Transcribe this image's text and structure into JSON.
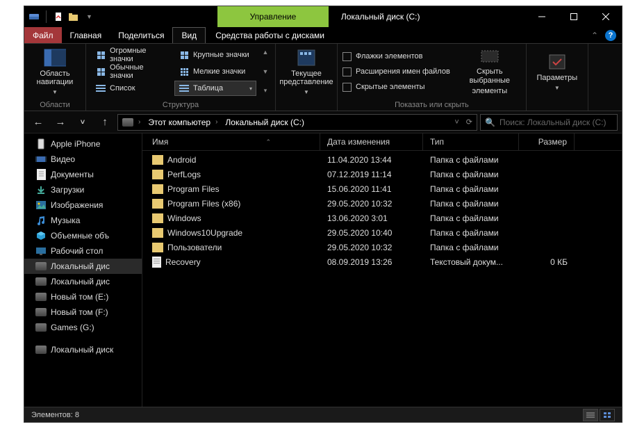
{
  "window": {
    "manage_tab": "Управление",
    "title": "Локальный диск (C:)"
  },
  "menu": {
    "file": "Файл",
    "home": "Главная",
    "share": "Поделиться",
    "view": "Вид",
    "drive_tools": "Средства работы с дисками"
  },
  "ribbon": {
    "nav_pane": "Область навигации",
    "panes_label": "Области",
    "views": {
      "extra_large": "Огромные значки",
      "large": "Крупные значки",
      "medium": "Обычные значки",
      "small": "Мелкие значки",
      "list": "Список",
      "details": "Таблица"
    },
    "layout_label": "Структура",
    "current_view": "Текущее представление",
    "checkboxes": "Флажки элементов",
    "extensions": "Расширения имен файлов",
    "hidden": "Скрытые элементы",
    "hide_selected_l1": "Скрыть выбранные",
    "hide_selected_l2": "элементы",
    "show_hide_label": "Показать или скрыть",
    "options": "Параметры"
  },
  "address": {
    "this_pc": "Этот компьютер",
    "current": "Локальный диск (C:)"
  },
  "search": {
    "placeholder": "Поиск: Локальный диск (C:)"
  },
  "tree": [
    {
      "icon": "phone",
      "label": "Apple iPhone"
    },
    {
      "icon": "video",
      "label": "Видео"
    },
    {
      "icon": "doc",
      "label": "Документы"
    },
    {
      "icon": "down",
      "label": "Загрузки"
    },
    {
      "icon": "pic",
      "label": "Изображения"
    },
    {
      "icon": "music",
      "label": "Музыка"
    },
    {
      "icon": "cube",
      "label": "Объемные объ"
    },
    {
      "icon": "desk",
      "label": "Рабочий стол"
    },
    {
      "icon": "drive",
      "label": "Локальный дис",
      "active": true
    },
    {
      "icon": "drive",
      "label": "Локальный дис"
    },
    {
      "icon": "drive",
      "label": "Новый том (E:)"
    },
    {
      "icon": "drive",
      "label": "Новый том (F:)"
    },
    {
      "icon": "drive",
      "label": "Games (G:)"
    },
    {
      "icon": "drive",
      "label": "Локальный диск"
    }
  ],
  "columns": {
    "name": "Имя",
    "date": "Дата изменения",
    "type": "Тип",
    "size": "Размер"
  },
  "files": [
    {
      "icon": "folder",
      "name": "Android",
      "date": "11.04.2020 13:44",
      "type": "Папка с файлами",
      "size": ""
    },
    {
      "icon": "folder",
      "name": "PerfLogs",
      "date": "07.12.2019 11:14",
      "type": "Папка с файлами",
      "size": ""
    },
    {
      "icon": "folder",
      "name": "Program Files",
      "date": "15.06.2020 11:41",
      "type": "Папка с файлами",
      "size": ""
    },
    {
      "icon": "folder",
      "name": "Program Files (x86)",
      "date": "29.05.2020 10:32",
      "type": "Папка с файлами",
      "size": ""
    },
    {
      "icon": "folder",
      "name": "Windows",
      "date": "13.06.2020 3:01",
      "type": "Папка с файлами",
      "size": ""
    },
    {
      "icon": "folder",
      "name": "Windows10Upgrade",
      "date": "29.05.2020 10:40",
      "type": "Папка с файлами",
      "size": ""
    },
    {
      "icon": "folder",
      "name": "Пользователи",
      "date": "29.05.2020 10:32",
      "type": "Папка с файлами",
      "size": ""
    },
    {
      "icon": "txt",
      "name": "Recovery",
      "date": "08.09.2019 13:26",
      "type": "Текстовый докум...",
      "size": "0 КБ"
    }
  ],
  "status": {
    "count": "Элементов: 8"
  }
}
